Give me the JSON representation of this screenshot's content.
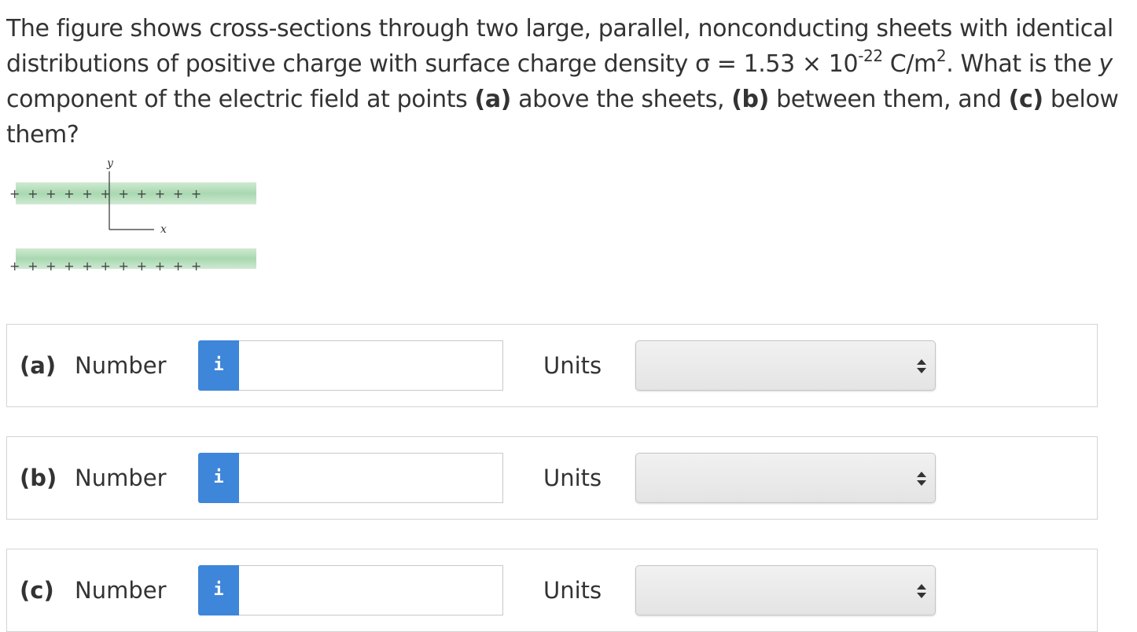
{
  "question": {
    "line1": "The figure shows cross-sections through two large, parallel, nonconducting sheets with identical",
    "line2_pre": "distributions of positive charge with surface charge density σ = 1.53 × 10",
    "line2_exp": "-22",
    "line2_unit": " C/m",
    "line2_unit_exp": "2",
    "line2_post": ". What is the ",
    "line2_var": "y",
    "line3_pre": "component of the electric field at points ",
    "part_a": "(a)",
    "text_a": " above the sheets, ",
    "part_b": "(b)",
    "text_b": " between them, and ",
    "part_c": "(c)",
    "text_c": " below them?"
  },
  "figure": {
    "y_label": "y",
    "x_label": "x",
    "top_sheet_signs": "+ + + + + + + + + + +",
    "bottom_sheet_signs": "+ + + + + + + + + + +",
    "sheet_color": "#a8d8b0"
  },
  "answers": [
    {
      "part": "(a)",
      "number_label": "Number",
      "info_glyph": "i",
      "value": "",
      "units_label": "Units",
      "units_value": ""
    },
    {
      "part": "(b)",
      "number_label": "Number",
      "info_glyph": "i",
      "value": "",
      "units_label": "Units",
      "units_value": ""
    },
    {
      "part": "(c)",
      "number_label": "Number",
      "info_glyph": "i",
      "value": "",
      "units_label": "Units",
      "units_value": ""
    }
  ],
  "colors": {
    "info_button": "#3e86d9",
    "text": "#333333",
    "border": "#d3d3d3"
  }
}
